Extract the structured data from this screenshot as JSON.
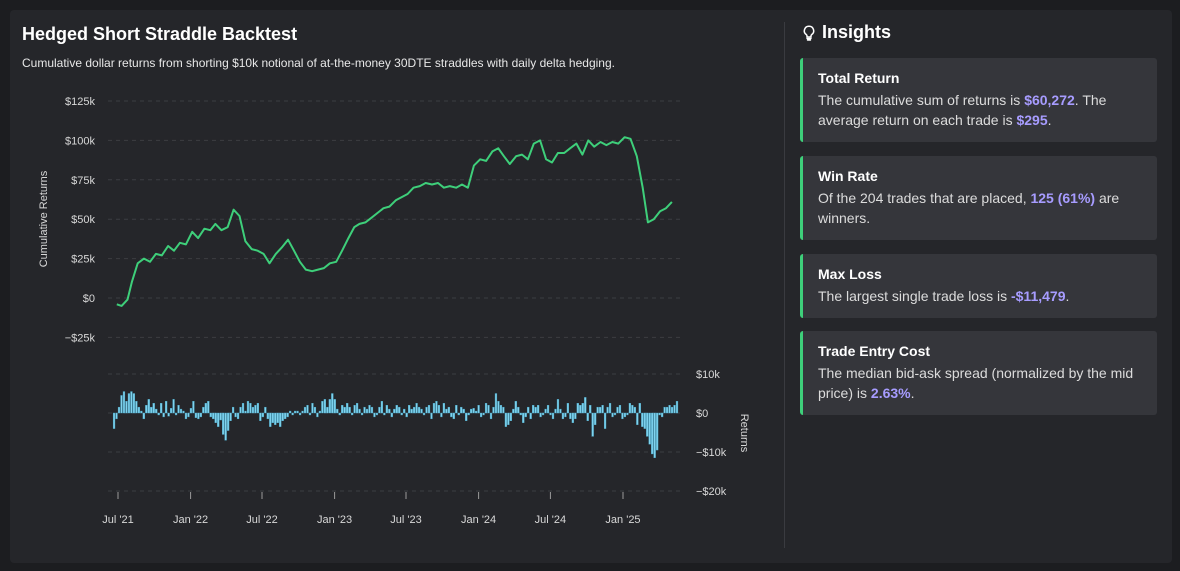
{
  "header": {
    "title": "Hedged Short Straddle Backtest",
    "subtitle": "Cumulative dollar returns from shorting $10k notional of at-the-money 30DTE straddles with daily delta hedging."
  },
  "insights": {
    "title": "Insights",
    "icon": "lightbulb-icon",
    "cards": [
      {
        "heading": "Total Return",
        "pre": "The cumulative sum of returns is ",
        "hl1": "$60,272",
        "mid": ". The average return on each trade is ",
        "hl2": "$295",
        "post": "."
      },
      {
        "heading": "Win Rate",
        "pre": "Of the 204 trades that are placed, ",
        "hl1": "125 (61%)",
        "mid": " are winners.",
        "hl2": "",
        "post": ""
      },
      {
        "heading": "Max Loss",
        "pre": "The largest single trade loss is ",
        "hl1": "-$11,479",
        "mid": ".",
        "hl2": "",
        "post": ""
      },
      {
        "heading": "Trade Entry Cost",
        "pre": "The median bid-ask spread (normalized by the mid price) is ",
        "hl1": "2.63%",
        "mid": ".",
        "hl2": "",
        "post": ""
      }
    ]
  },
  "colors": {
    "line": "#3ecf7a",
    "bar": "#7fd3ee",
    "accent": "#3ecf7a",
    "highlight": "#a79cff"
  },
  "chart_data": [
    {
      "type": "line",
      "ylabel": "Cumulative Returns",
      "ylim": [
        -25000,
        125000
      ],
      "yticks": [
        -25000,
        0,
        25000,
        50000,
        75000,
        100000,
        125000
      ],
      "ytick_labels": [
        "−$25k",
        "$0",
        "$25k",
        "$50k",
        "$75k",
        "$100k",
        "$125k"
      ],
      "xlim": [
        "2021-07-01",
        "2025-05-15"
      ],
      "xticks": [
        "2021-07-01",
        "2022-01-01",
        "2022-07-01",
        "2023-01-01",
        "2023-07-01",
        "2024-01-01",
        "2024-07-01",
        "2025-01-01"
      ],
      "xtick_labels": [
        "Jul '21",
        "Jan '22",
        "Jul '22",
        "Jan '23",
        "Jul '23",
        "Jan '24",
        "Jul '24",
        "Jan '25"
      ],
      "grid": true,
      "x": [
        "2021-06-28",
        "2021-07-10",
        "2021-07-25",
        "2021-08-05",
        "2021-08-20",
        "2021-09-05",
        "2021-09-20",
        "2021-10-05",
        "2021-10-20",
        "2021-11-05",
        "2021-11-20",
        "2021-12-05",
        "2021-12-20",
        "2022-01-05",
        "2022-01-20",
        "2022-02-05",
        "2022-02-20",
        "2022-03-05",
        "2022-03-20",
        "2022-04-05",
        "2022-04-20",
        "2022-05-05",
        "2022-05-20",
        "2022-06-05",
        "2022-06-20",
        "2022-07-05",
        "2022-07-20",
        "2022-08-05",
        "2022-08-20",
        "2022-09-05",
        "2022-09-20",
        "2022-10-05",
        "2022-10-20",
        "2022-11-05",
        "2022-11-20",
        "2022-12-05",
        "2022-12-20",
        "2023-01-05",
        "2023-01-20",
        "2023-02-05",
        "2023-02-20",
        "2023-03-05",
        "2023-03-20",
        "2023-04-05",
        "2023-04-20",
        "2023-05-05",
        "2023-05-20",
        "2023-06-05",
        "2023-06-20",
        "2023-07-05",
        "2023-07-20",
        "2023-08-05",
        "2023-08-20",
        "2023-09-05",
        "2023-09-20",
        "2023-10-05",
        "2023-10-20",
        "2023-11-05",
        "2023-11-20",
        "2023-12-05",
        "2023-12-20",
        "2024-01-05",
        "2024-01-20",
        "2024-02-05",
        "2024-02-20",
        "2024-03-05",
        "2024-03-20",
        "2024-04-05",
        "2024-04-20",
        "2024-05-05",
        "2024-05-20",
        "2024-06-05",
        "2024-06-20",
        "2024-07-05",
        "2024-07-20",
        "2024-08-05",
        "2024-08-20",
        "2024-09-05",
        "2024-09-20",
        "2024-10-05",
        "2024-10-20",
        "2024-11-05",
        "2024-11-20",
        "2024-12-05",
        "2024-12-20",
        "2025-01-05",
        "2025-01-20",
        "2025-02-05",
        "2025-02-20",
        "2025-03-05",
        "2025-03-20",
        "2025-04-05",
        "2025-04-20",
        "2025-05-05"
      ],
      "values": [
        -4000,
        -5000,
        -1000,
        10000,
        22000,
        25000,
        23000,
        28000,
        27000,
        33000,
        30000,
        35000,
        34000,
        42000,
        38000,
        44000,
        43000,
        47000,
        43000,
        45000,
        56000,
        52000,
        36000,
        31000,
        30000,
        28000,
        22000,
        28000,
        32000,
        37000,
        30000,
        23000,
        18000,
        17000,
        18000,
        19000,
        22000,
        23000,
        30000,
        38000,
        45000,
        47000,
        48000,
        51000,
        54000,
        57000,
        58000,
        62000,
        64000,
        66000,
        70000,
        71000,
        73000,
        72000,
        73000,
        70000,
        71000,
        70000,
        72000,
        70000,
        84000,
        88000,
        87000,
        93000,
        95000,
        90000,
        85000,
        90000,
        91000,
        88000,
        98000,
        100000,
        88000,
        86000,
        92000,
        92000,
        95000,
        98000,
        91000,
        100000,
        96000,
        99000,
        97000,
        99000,
        98000,
        102000,
        101000,
        90000,
        70000,
        48000,
        50000,
        55000,
        57000,
        61000
      ]
    },
    {
      "type": "bar",
      "ylabel": "Returns",
      "ylim": [
        -20000,
        10000
      ],
      "yticks": [
        -20000,
        -10000,
        0,
        10000
      ],
      "ytick_labels": [
        "−$20k",
        "−$10k",
        "$0",
        "$10k"
      ],
      "x_start": "2021-07-01",
      "x_step_days": 7,
      "values": [
        -4000,
        -1500,
        1500,
        4500,
        5500,
        3000,
        5000,
        5500,
        5000,
        3000,
        1500,
        500,
        -1500,
        2000,
        3500,
        1500,
        2500,
        1000,
        -500,
        2500,
        -1000,
        3000,
        -800,
        1200,
        3500,
        -500,
        2000,
        1000,
        500,
        -1500,
        -1000,
        1200,
        3000,
        -1200,
        -1500,
        -1000,
        1500,
        2500,
        3000,
        -1000,
        -1500,
        -2500,
        -3500,
        -1800,
        -5500,
        -7000,
        -4500,
        -2000,
        1500,
        -1000,
        -1500,
        1500,
        2500,
        500,
        3000,
        2500,
        1500,
        2000,
        2500,
        -2000,
        -1000,
        1500,
        -1500,
        -3500,
        -2500,
        -3000,
        -2500,
        -3500,
        -2000,
        -1500,
        -1000,
        500,
        -500,
        500,
        500,
        -500,
        500,
        1500,
        2000,
        -500,
        2500,
        1500,
        -1000,
        500,
        3000,
        3500,
        1500,
        3500,
        5000,
        3500,
        1000,
        -500,
        2000,
        1500,
        2500,
        1500,
        -500,
        2000,
        2500,
        1000,
        -500,
        1500,
        1000,
        2000,
        1500,
        -1000,
        -500,
        1500,
        3000,
        -500,
        2000,
        1000,
        -1000,
        1000,
        2000,
        1500,
        -500,
        1000,
        -1000,
        2000,
        1000,
        1500,
        2500,
        1500,
        1000,
        -500,
        1500,
        2000,
        -1500,
        2500,
        3000,
        2000,
        -1000,
        2500,
        1000,
        1500,
        -1000,
        -1500,
        2000,
        -500,
        1500,
        1000,
        -2000,
        -500,
        1000,
        1200,
        500,
        2000,
        -1000,
        -500,
        2500,
        2000,
        -1500,
        1500,
        5000,
        3000,
        2000,
        1500,
        -3500,
        -3000,
        -2000,
        1000,
        3000,
        1500,
        -500,
        -2500,
        -1000,
        1500,
        -1500,
        2000,
        1500,
        2000,
        -1000,
        -500,
        1000,
        2000,
        -500,
        -1500,
        1000,
        3500,
        1000,
        -1500,
        -1000,
        2500,
        -1500,
        -2500,
        -1500,
        2500,
        2000,
        2500,
        4000,
        -2000,
        2000,
        -6000,
        -3000,
        1500,
        1500,
        2000,
        -4000,
        1500,
        2500,
        -1000,
        -500,
        1500,
        2000,
        -1500,
        -1000,
        -500,
        2500,
        2000,
        1500,
        -3000,
        2500,
        -3500,
        -4000,
        -6000,
        -8000,
        -10500,
        -11479,
        -9500,
        -500,
        -1000,
        1500,
        1500,
        2000,
        1500,
        2000,
        3000
      ]
    }
  ]
}
